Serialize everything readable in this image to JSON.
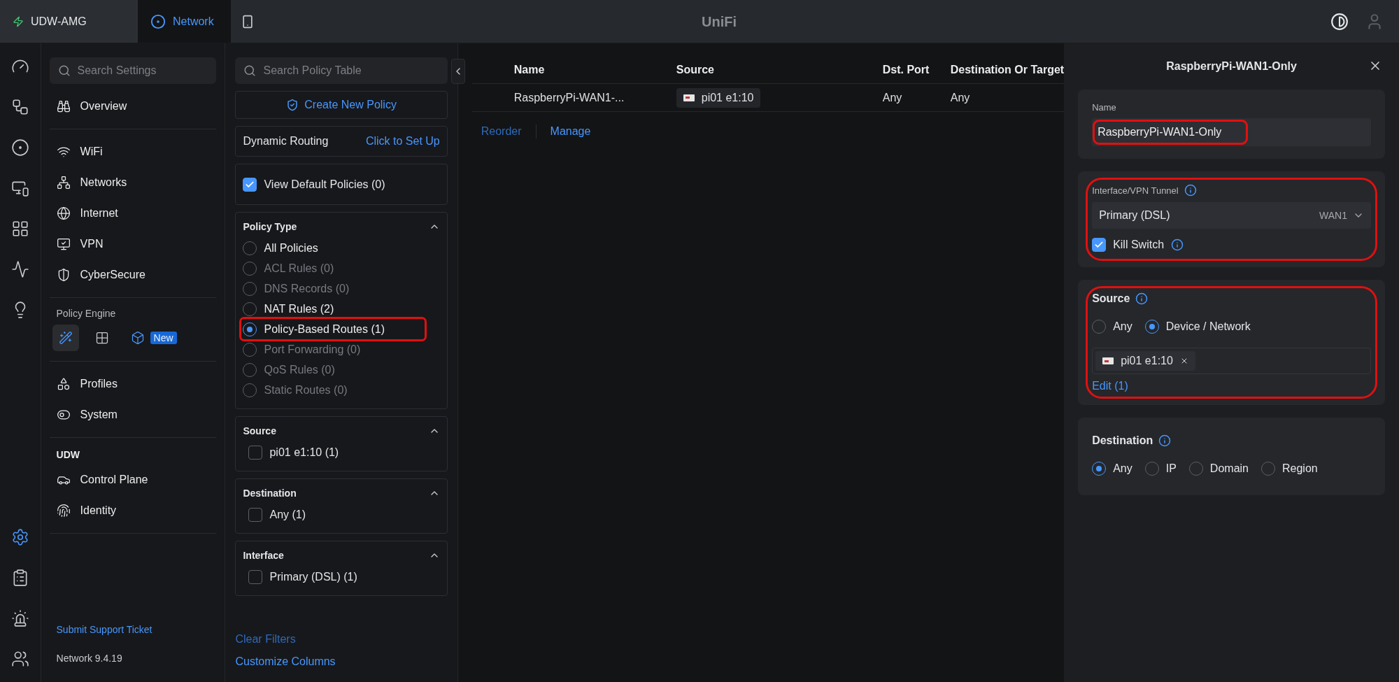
{
  "top_bar": {
    "tabs": [
      {
        "label": "UDW-AMG",
        "selected": false
      },
      {
        "label": "Network",
        "selected": true
      }
    ],
    "logo": "UniFi"
  },
  "rail": [
    {
      "selected": false
    },
    {
      "selected": false
    },
    {
      "selected": false
    },
    {
      "selected": false
    },
    {
      "selected": false
    },
    {
      "selected": false
    },
    {
      "selected": false
    },
    {
      "selected": true
    },
    {
      "selected": false
    },
    {
      "selected": false
    },
    {
      "selected": false
    }
  ],
  "settings": {
    "search": {
      "placeholder": "Search Settings"
    },
    "sections": [
      {
        "items": [
          "Overview"
        ]
      },
      {
        "items": [
          "WiFi",
          "Networks",
          "Internet",
          "VPN",
          "CyberSecure"
        ]
      },
      {
        "heading": "Policy Engine",
        "tools": [
          {
            "selected": true
          },
          {
            "selected": false
          },
          {
            "selected": false,
            "badge": "New"
          }
        ]
      },
      {
        "items": [
          "Profiles",
          "System"
        ]
      },
      {
        "heading": "UDW",
        "items": [
          "Control Plane",
          "Identity"
        ]
      }
    ],
    "support_link": "Submit Support Ticket",
    "version": "Network 9.4.19"
  },
  "filters": {
    "search": {
      "placeholder": "Search Policy Table"
    },
    "create_button": "Create New Policy",
    "dynamic_routing": {
      "label": "Dynamic Routing",
      "action": "Click to Set Up"
    },
    "view_default": {
      "label": "View Default Policies (0)",
      "checked": true
    },
    "groups": [
      {
        "title": "Policy Type",
        "kind": "radio",
        "expanded": true,
        "options": [
          {
            "label": "All Policies",
            "selected": false,
            "disabled": false,
            "annotated": false
          },
          {
            "label": "ACL Rules (0)",
            "selected": false,
            "disabled": true,
            "annotated": false
          },
          {
            "label": "DNS Records (0)",
            "selected": false,
            "disabled": true,
            "annotated": false
          },
          {
            "label": "NAT Rules (2)",
            "selected": false,
            "disabled": false,
            "annotated": false
          },
          {
            "label": "Policy-Based Routes (1)",
            "selected": true,
            "disabled": false,
            "annotated": true
          },
          {
            "label": "Port Forwarding (0)",
            "selected": false,
            "disabled": true,
            "annotated": false
          },
          {
            "label": "QoS Rules (0)",
            "selected": false,
            "disabled": true,
            "annotated": false
          },
          {
            "label": "Static Routes (0)",
            "selected": false,
            "disabled": true,
            "annotated": false
          }
        ]
      },
      {
        "title": "Source",
        "kind": "checkbox",
        "expanded": true,
        "options": [
          {
            "label": "pi01 e1:10 (1)",
            "checked": false
          }
        ]
      },
      {
        "title": "Destination",
        "kind": "checkbox",
        "expanded": true,
        "options": [
          {
            "label": "Any (1)",
            "checked": false
          }
        ]
      },
      {
        "title": "Interface",
        "kind": "checkbox",
        "expanded": true,
        "options": [
          {
            "label": "Primary (DSL) (1)",
            "checked": false
          }
        ]
      }
    ],
    "links": [
      {
        "label": "Clear Filters",
        "disabled": true
      },
      {
        "label": "Customize Columns",
        "disabled": false
      }
    ]
  },
  "table": {
    "columns": [
      "Name",
      "Source",
      "Dst. Port",
      "Destination Or Target"
    ],
    "rows": [
      {
        "cells": [
          {
            "kind": "text",
            "text": "RaspberryPi-WAN1-..."
          },
          {
            "kind": "chip",
            "text": "pi01 e1:10"
          },
          {
            "kind": "text",
            "text": "Any"
          },
          {
            "kind": "text",
            "text": "Any"
          }
        ]
      }
    ],
    "actions": [
      {
        "label": "Reorder",
        "disabled": true
      },
      {
        "label": "Manage",
        "disabled": false
      }
    ]
  },
  "detail": {
    "title": "RaspberryPi-WAN1-Only",
    "name": {
      "label": "Name",
      "value": "RaspberryPi-WAN1-Only",
      "annotated": true
    },
    "interface": {
      "label": "Interface/VPN Tunnel",
      "value": "Primary (DSL)",
      "tag": "WAN1",
      "kill_switch": {
        "label": "Kill Switch",
        "checked": true
      },
      "annotated": true
    },
    "source": {
      "title": "Source",
      "options": [
        {
          "label": "Any",
          "selected": false
        },
        {
          "label": "Device / Network",
          "selected": true
        }
      ],
      "chips": [
        "pi01 e1:10"
      ],
      "edit_link": "Edit (1)",
      "annotated": true
    },
    "destination": {
      "title": "Destination",
      "options": [
        {
          "label": "Any",
          "selected": true
        },
        {
          "label": "IP",
          "selected": false
        },
        {
          "label": "Domain",
          "selected": false
        },
        {
          "label": "Region",
          "selected": false
        }
      ],
      "annotated": false
    }
  }
}
